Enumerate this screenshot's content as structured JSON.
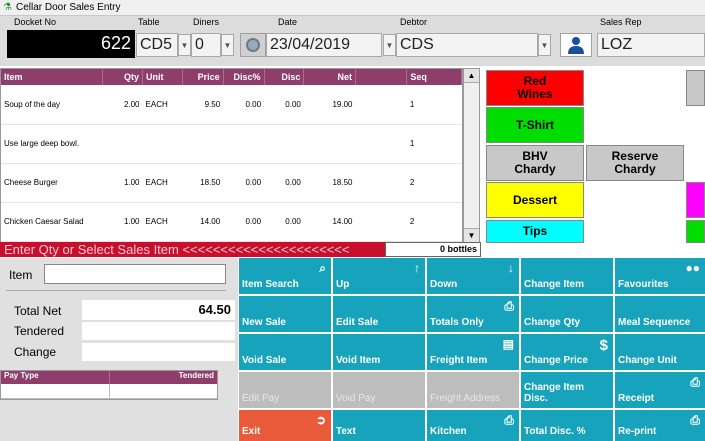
{
  "title": "Cellar Door Sales Entry",
  "header": {
    "docket_label": "Docket No",
    "docket_no": "622",
    "table_label": "Table",
    "table_value": "CD5",
    "diners_label": "Diners",
    "diners_value": "0",
    "date_label": "Date",
    "date_value": "23/04/2019",
    "debtor_label": "Debtor",
    "debtor_value": "CDS",
    "salesrep_label": "Sales Rep",
    "salesrep_value": "LOZ"
  },
  "grid": {
    "columns": [
      "Item",
      "Qty",
      "Unit",
      "Price",
      "Disc%",
      "Disc",
      "Net",
      "",
      "Seq"
    ],
    "rows": [
      {
        "item": "Soup of the day",
        "qty": "2.00",
        "unit": "EACH",
        "price": "9.50",
        "discp": "0.00",
        "disc": "0.00",
        "net": "19.00",
        "seq": "1"
      },
      {
        "item": "Use large deep bowl.",
        "qty": "",
        "unit": "",
        "price": "",
        "discp": "",
        "disc": "",
        "net": "",
        "seq": "1"
      },
      {
        "item": "Cheese Burger",
        "qty": "1.00",
        "unit": "EACH",
        "price": "18.50",
        "discp": "0.00",
        "disc": "0.00",
        "net": "18.50",
        "seq": "2"
      },
      {
        "item": "Chicken Caesar Salad",
        "qty": "1.00",
        "unit": "EACH",
        "price": "14.00",
        "discp": "0.00",
        "disc": "0.00",
        "net": "14.00",
        "seq": "2"
      }
    ]
  },
  "categories": [
    {
      "label": "Red\nWines",
      "color": "#ff0000",
      "text_color": "#000000"
    },
    {
      "label": "T-Shirt",
      "color": "#00dd00",
      "text_color": "#000000"
    },
    {
      "label": "BHV\nChardy",
      "color": "#c8c8c8",
      "text_color": "#000000"
    },
    {
      "label": "Reserve\nChardy",
      "color": "#c8c8c8",
      "text_color": "#000000"
    },
    {
      "label": "Dessert",
      "color": "#ffff00",
      "text_color": "#000000"
    },
    {
      "label": "Tips",
      "color": "#00ffff",
      "text_color": "#000000"
    }
  ],
  "status": {
    "prompt": "Enter Qty or Select Sales Item <<<<<<<<<<<<<<<<<<<<<<",
    "bottles": "0 bottles"
  },
  "left": {
    "item_label": "Item",
    "total_net_label": "Total Net",
    "total_net_value": "64.50",
    "tendered_label": "Tendered",
    "change_label": "Change",
    "pay_type_col": "Pay Type",
    "tendered_col": "Tendered"
  },
  "buttons": {
    "item_search": "Item Search",
    "up": "Up",
    "down": "Down",
    "change_item": "Change Item",
    "favourites": "Favourites",
    "new_sale": "New Sale",
    "edit_sale": "Edit Sale",
    "totals_only": "Totals Only",
    "change_qty": "Change Qty",
    "meal_sequence": "Meal Sequence",
    "void_sale": "Void Sale",
    "void_item": "Void Item",
    "freight_item": "Freight Item",
    "change_price": "Change Price",
    "change_unit": "Change Unit",
    "edit_pay": "Edit Pay",
    "void_pay": "Void Pay",
    "freight_address": "Freight Address",
    "change_item_disc": "Change Item\nDisc.",
    "receipt": "Receipt",
    "exit": "Exit",
    "text": "Text",
    "kitchen": "Kitchen",
    "total_disc": "Total Disc. %",
    "reprint": "Re-print"
  }
}
